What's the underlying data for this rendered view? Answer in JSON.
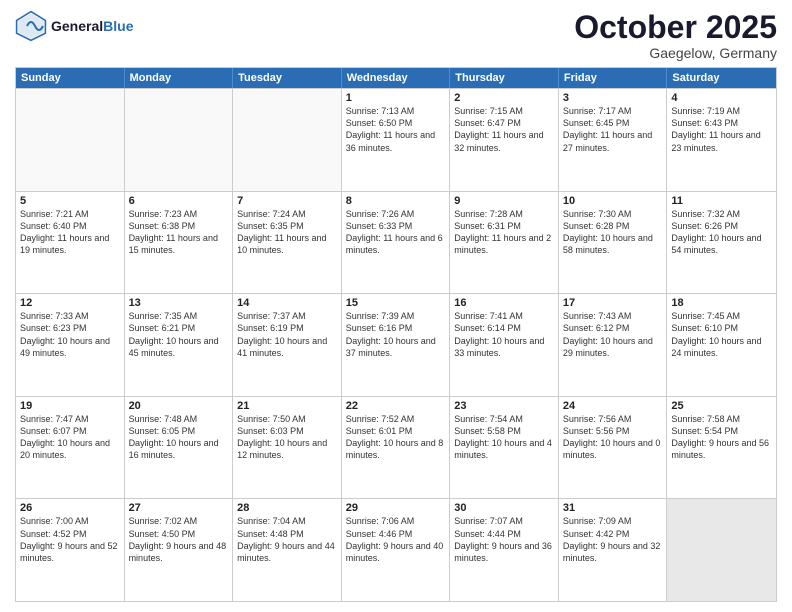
{
  "header": {
    "logo_line1": "General",
    "logo_line2": "Blue",
    "month": "October 2025",
    "location": "Gaegelow, Germany"
  },
  "days_of_week": [
    "Sunday",
    "Monday",
    "Tuesday",
    "Wednesday",
    "Thursday",
    "Friday",
    "Saturday"
  ],
  "rows": [
    [
      {
        "day": "",
        "text": "",
        "empty": true
      },
      {
        "day": "",
        "text": "",
        "empty": true
      },
      {
        "day": "",
        "text": "",
        "empty": true
      },
      {
        "day": "1",
        "text": "Sunrise: 7:13 AM\nSunset: 6:50 PM\nDaylight: 11 hours and 36 minutes."
      },
      {
        "day": "2",
        "text": "Sunrise: 7:15 AM\nSunset: 6:47 PM\nDaylight: 11 hours and 32 minutes."
      },
      {
        "day": "3",
        "text": "Sunrise: 7:17 AM\nSunset: 6:45 PM\nDaylight: 11 hours and 27 minutes."
      },
      {
        "day": "4",
        "text": "Sunrise: 7:19 AM\nSunset: 6:43 PM\nDaylight: 11 hours and 23 minutes."
      }
    ],
    [
      {
        "day": "5",
        "text": "Sunrise: 7:21 AM\nSunset: 6:40 PM\nDaylight: 11 hours and 19 minutes."
      },
      {
        "day": "6",
        "text": "Sunrise: 7:23 AM\nSunset: 6:38 PM\nDaylight: 11 hours and 15 minutes."
      },
      {
        "day": "7",
        "text": "Sunrise: 7:24 AM\nSunset: 6:35 PM\nDaylight: 11 hours and 10 minutes."
      },
      {
        "day": "8",
        "text": "Sunrise: 7:26 AM\nSunset: 6:33 PM\nDaylight: 11 hours and 6 minutes."
      },
      {
        "day": "9",
        "text": "Sunrise: 7:28 AM\nSunset: 6:31 PM\nDaylight: 11 hours and 2 minutes."
      },
      {
        "day": "10",
        "text": "Sunrise: 7:30 AM\nSunset: 6:28 PM\nDaylight: 10 hours and 58 minutes."
      },
      {
        "day": "11",
        "text": "Sunrise: 7:32 AM\nSunset: 6:26 PM\nDaylight: 10 hours and 54 minutes."
      }
    ],
    [
      {
        "day": "12",
        "text": "Sunrise: 7:33 AM\nSunset: 6:23 PM\nDaylight: 10 hours and 49 minutes."
      },
      {
        "day": "13",
        "text": "Sunrise: 7:35 AM\nSunset: 6:21 PM\nDaylight: 10 hours and 45 minutes."
      },
      {
        "day": "14",
        "text": "Sunrise: 7:37 AM\nSunset: 6:19 PM\nDaylight: 10 hours and 41 minutes."
      },
      {
        "day": "15",
        "text": "Sunrise: 7:39 AM\nSunset: 6:16 PM\nDaylight: 10 hours and 37 minutes."
      },
      {
        "day": "16",
        "text": "Sunrise: 7:41 AM\nSunset: 6:14 PM\nDaylight: 10 hours and 33 minutes."
      },
      {
        "day": "17",
        "text": "Sunrise: 7:43 AM\nSunset: 6:12 PM\nDaylight: 10 hours and 29 minutes."
      },
      {
        "day": "18",
        "text": "Sunrise: 7:45 AM\nSunset: 6:10 PM\nDaylight: 10 hours and 24 minutes."
      }
    ],
    [
      {
        "day": "19",
        "text": "Sunrise: 7:47 AM\nSunset: 6:07 PM\nDaylight: 10 hours and 20 minutes."
      },
      {
        "day": "20",
        "text": "Sunrise: 7:48 AM\nSunset: 6:05 PM\nDaylight: 10 hours and 16 minutes."
      },
      {
        "day": "21",
        "text": "Sunrise: 7:50 AM\nSunset: 6:03 PM\nDaylight: 10 hours and 12 minutes."
      },
      {
        "day": "22",
        "text": "Sunrise: 7:52 AM\nSunset: 6:01 PM\nDaylight: 10 hours and 8 minutes."
      },
      {
        "day": "23",
        "text": "Sunrise: 7:54 AM\nSunset: 5:58 PM\nDaylight: 10 hours and 4 minutes."
      },
      {
        "day": "24",
        "text": "Sunrise: 7:56 AM\nSunset: 5:56 PM\nDaylight: 10 hours and 0 minutes."
      },
      {
        "day": "25",
        "text": "Sunrise: 7:58 AM\nSunset: 5:54 PM\nDaylight: 9 hours and 56 minutes."
      }
    ],
    [
      {
        "day": "26",
        "text": "Sunrise: 7:00 AM\nSunset: 4:52 PM\nDaylight: 9 hours and 52 minutes."
      },
      {
        "day": "27",
        "text": "Sunrise: 7:02 AM\nSunset: 4:50 PM\nDaylight: 9 hours and 48 minutes."
      },
      {
        "day": "28",
        "text": "Sunrise: 7:04 AM\nSunset: 4:48 PM\nDaylight: 9 hours and 44 minutes."
      },
      {
        "day": "29",
        "text": "Sunrise: 7:06 AM\nSunset: 4:46 PM\nDaylight: 9 hours and 40 minutes."
      },
      {
        "day": "30",
        "text": "Sunrise: 7:07 AM\nSunset: 4:44 PM\nDaylight: 9 hours and 36 minutes."
      },
      {
        "day": "31",
        "text": "Sunrise: 7:09 AM\nSunset: 4:42 PM\nDaylight: 9 hours and 32 minutes."
      },
      {
        "day": "",
        "text": "",
        "empty": true,
        "shaded": true
      }
    ]
  ]
}
